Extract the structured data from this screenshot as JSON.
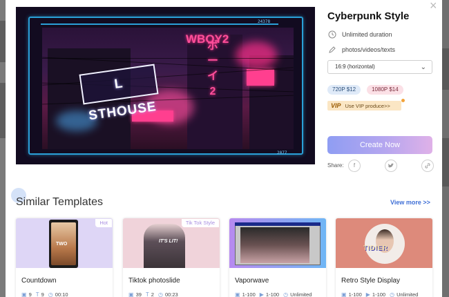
{
  "window": {
    "close_glyph": "×"
  },
  "preview": {
    "neon_sign_text": "L STHOUSE",
    "vertical_text_1": "WBOY2",
    "vertical_text_2": "ボーイ2",
    "corner_top_text": "24378",
    "corner_bottom_text": "2077"
  },
  "details": {
    "title": "Cyberpunk Style",
    "duration_label": "Unlimited duration",
    "media_label": "photos/videos/texts",
    "aspect_select": {
      "selected": "16:9 (horizontal)",
      "chevron": "⌄"
    },
    "prices": [
      {
        "label": "720P  $12"
      },
      {
        "label": "1080P  $14"
      }
    ],
    "vip": {
      "badge": "VIP",
      "label": "Use VIP produce>>"
    },
    "create_button": "Create Now",
    "share_label": "Share:",
    "share_icons": [
      {
        "name": "facebook-icon",
        "glyph": "f"
      },
      {
        "name": "twitter-icon",
        "glyph": "🐦"
      },
      {
        "name": "link-icon",
        "glyph": "🔗"
      }
    ]
  },
  "similar": {
    "title": "Similar Templates",
    "view_more": "View more >>",
    "cards": [
      {
        "name": "Countdown",
        "badge": "Hot",
        "images": "9",
        "texts": "9",
        "duration": "00:10"
      },
      {
        "name": "Tiktok photoslide",
        "badge": "Tik Tok Style",
        "images": "39",
        "texts": "2",
        "duration": "00:23"
      },
      {
        "name": "Vaporwave",
        "badge": "",
        "images": "1-100",
        "videos": "1-100",
        "duration": "Unlimited"
      },
      {
        "name": "Retro Style Display",
        "badge": "",
        "images": "1-100",
        "videos": "1-100",
        "duration": "Unlimited"
      }
    ]
  },
  "colors": {
    "accent_blue": "#3f6fd6",
    "create_gradient_start": "#8f9df3",
    "create_gradient_end": "#dfb1e8",
    "neon_frame": "#2aa0d8",
    "neon_pink": "#ff3f8f"
  }
}
